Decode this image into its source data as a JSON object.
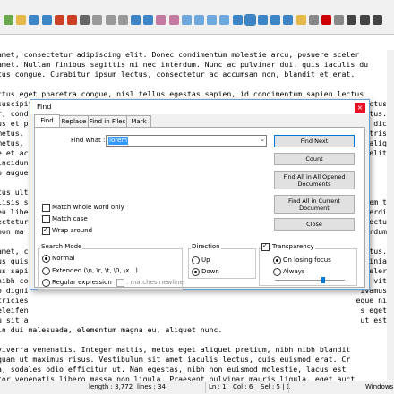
{
  "toolbar": {
    "icons": [
      "new-file-icon",
      "open-file-icon",
      "save-icon",
      "save-all-icon",
      "close-icon",
      "close-all-icon",
      "print-icon",
      "cut-icon",
      "copy-icon",
      "paste-icon",
      "undo-icon",
      "redo-icon",
      "find-icon",
      "replace-icon",
      "zoom-in-icon",
      "zoom-out-icon",
      "sync-v-icon",
      "sync-h-icon",
      "word-wrap-icon",
      "show-all-chars-icon",
      "indent-guide-icon",
      "doc-map-icon",
      "function-list-icon",
      "folder-workspace-icon",
      "monitor-icon",
      "record-macro-icon",
      "stop-record-icon",
      "play-macro-icon",
      "play-multiple-icon",
      "save-macro-icon"
    ]
  },
  "editor": {
    "lines": [
      "amet, consectetur adipiscing elit. Donec condimentum molestie arcu, posuere sceler",
      "amet. Nullam finibus sagittis mi nec interdum. Nunc ac pulvinar dui, quis iaculis du",
      "tus congue. Curabitur ipsum lectus, consectetur ac accumsan non, blandit et erat.",
      "",
      "ctus eget pharetra congue, nisl tellus egestas sapien, id condimentum sapien lectus",
      "suscipit",
      "r, cond",
      "us et p",
      "metus,",
      "metus,",
      "e et ac",
      "incidun",
      "p augue",
      "",
      "tus ult",
      "lisis s",
      "eu libe",
      "ectetur",
      "non ma",
      "",
      "amet, c",
      "us quis",
      "us sapi",
      "nibh co",
      "o digni",
      "tricies",
      "eleifen",
      "u sit a",
      "in dui malesuada, elementum magna eu, aliquet nunc.",
      "",
      "viverra venenatis. Integer mattis, metus eget aliquet pretium, nibh nibh blandit",
      "quam ut maximus risus. Vestibulum sit amet iaculis lectus, quis euismod erat. Cr",
      "a, sodales odio efficitur ut. Nam egestas, nibh non euismod molestie, lacus est",
      "tor venenatis libero massa non ligula. Praesent pulvinar mauris ligula, eget auct"
    ],
    "right_fragments": [
      {
        "line": 5,
        "text": "lectus"
      },
      {
        "line": 6,
        "text": "ectus."
      },
      {
        "line": 7,
        "text": "n dic"
      },
      {
        "line": 8,
        "text": "ae tris"
      },
      {
        "line": 9,
        "text": "ue aliq"
      },
      {
        "line": 10,
        "text": "n velit"
      },
      {
        "line": 15,
        "text": "Lorem t"
      },
      {
        "line": 16,
        "text": "imperdi"
      },
      {
        "line": 17,
        "text": "t lectu"
      },
      {
        "line": 18,
        "text": "nterdum"
      },
      {
        "line": 20,
        "text": "metus."
      },
      {
        "line": 21,
        "text": "lacinia"
      },
      {
        "line": 22,
        "text": "sceler"
      },
      {
        "line": 23,
        "text": "dum vit"
      },
      {
        "line": 24,
        "text": "ivamus"
      },
      {
        "line": 25,
        "text": "eque ni"
      },
      {
        "line": 26,
        "text": "s eget"
      },
      {
        "line": 27,
        "text": "ut est"
      }
    ]
  },
  "dialog": {
    "title": "Find",
    "close_glyph": "×",
    "tabs": [
      "Find",
      "Replace",
      "Find in Files",
      "Mark"
    ],
    "find_what_label": "Find what :",
    "find_what_value": "lorem",
    "buttons": {
      "find_next": "Find Next",
      "count": "Count",
      "find_all_opened": "Find All in All Opened Documents",
      "find_all_current": "Find All in Current Document",
      "close": "Close"
    },
    "options": {
      "match_whole_word": "Match whole word only",
      "match_case": "Match case",
      "wrap_around": "Wrap around"
    },
    "search_mode": {
      "title": "Search Mode",
      "normal": "Normal",
      "extended": "Extended (\\n, \\r, \\t, \\0, \\x...)",
      "regex": "Regular expression",
      "matches_newline": ". matches newline"
    },
    "direction": {
      "title": "Direction",
      "up": "Up",
      "down": "Down"
    },
    "transparency": {
      "title": "Transparency",
      "on_losing_focus": "On losing focus",
      "always": "Always",
      "level": 0.7
    }
  },
  "statusbar": {
    "length": "length : 3,772",
    "lines": "lines : 34",
    "ln": "Ln : 1",
    "col": "Col : 6",
    "sel": "Sel : 5 | 1",
    "eol": "Windows"
  }
}
